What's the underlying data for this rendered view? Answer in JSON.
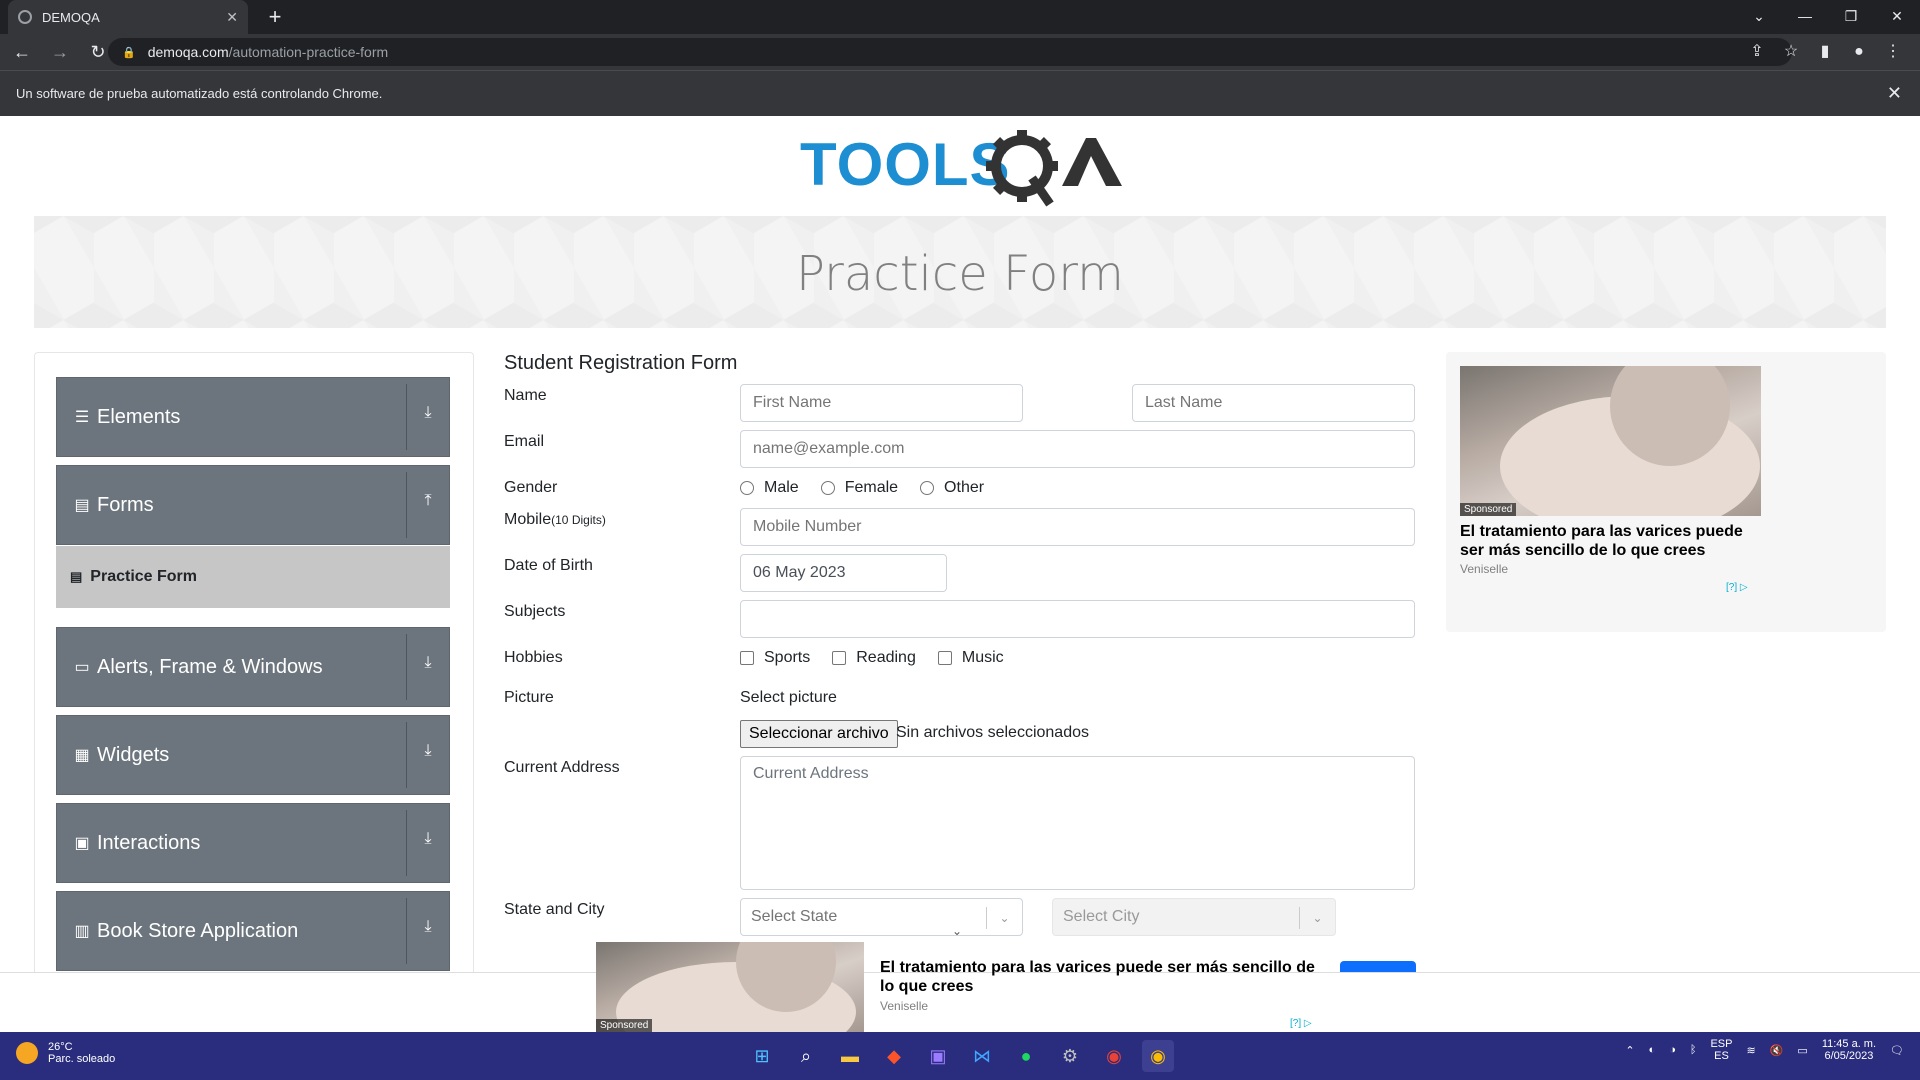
{
  "browser": {
    "tab_title": "DEMOQA",
    "url_host": "demoqa.com",
    "url_path": "/automation-practice-form",
    "infobar_text": "Un software de prueba automatizado está controlando Chrome."
  },
  "page": {
    "banner_title": "Practice Form"
  },
  "sidebar": {
    "groups": [
      {
        "label": "Elements"
      },
      {
        "label": "Forms"
      },
      {
        "label": "Alerts, Frame & Windows"
      },
      {
        "label": "Widgets"
      },
      {
        "label": "Interactions"
      },
      {
        "label": "Book Store Application"
      }
    ],
    "active_item": "Practice Form"
  },
  "form": {
    "title": "Student Registration Form",
    "name_label": "Name",
    "first_name_placeholder": "First Name",
    "last_name_placeholder": "Last Name",
    "email_label": "Email",
    "email_placeholder": "name@example.com",
    "gender_label": "Gender",
    "gender_options": [
      "Male",
      "Female",
      "Other"
    ],
    "mobile_label": "Mobile",
    "mobile_hint": "(10 Digits)",
    "mobile_placeholder": "Mobile Number",
    "dob_label": "Date of Birth",
    "dob_value": "06 May 2023",
    "subjects_label": "Subjects",
    "hobbies_label": "Hobbies",
    "hobby_options": [
      "Sports",
      "Reading",
      "Music"
    ],
    "picture_label": "Picture",
    "picture_caption": "Select picture",
    "file_button": "Seleccionar archivo",
    "file_status": "Sin archivos seleccionados",
    "address_label": "Current Address",
    "address_placeholder": "Current Address",
    "state_city_label": "State and City",
    "state_placeholder": "Select State",
    "city_placeholder": "Select City"
  },
  "ads": {
    "sponsored": "Sponsored",
    "right_headline": "El tratamiento para las varices puede ser más sencillo de lo que crees",
    "right_brand": "Veniselle",
    "bottom_headline": "El tratamiento para las varices puede ser más sencillo de lo que crees",
    "bottom_brand": "Veniselle",
    "choice": "[?]"
  },
  "taskbar": {
    "temperature": "26°C",
    "weather": "Parc. soleado",
    "lang_top": "ESP",
    "lang_bottom": "ES",
    "time": "11:45 a. m.",
    "date": "6/05/2023"
  },
  "colors": {
    "sidebar_group": "#6c757d",
    "sidebar_active": "#c6c6c6",
    "logo_blue": "#1c8ed1",
    "logo_dark": "#333333",
    "taskbar": "#2a2d7e"
  }
}
